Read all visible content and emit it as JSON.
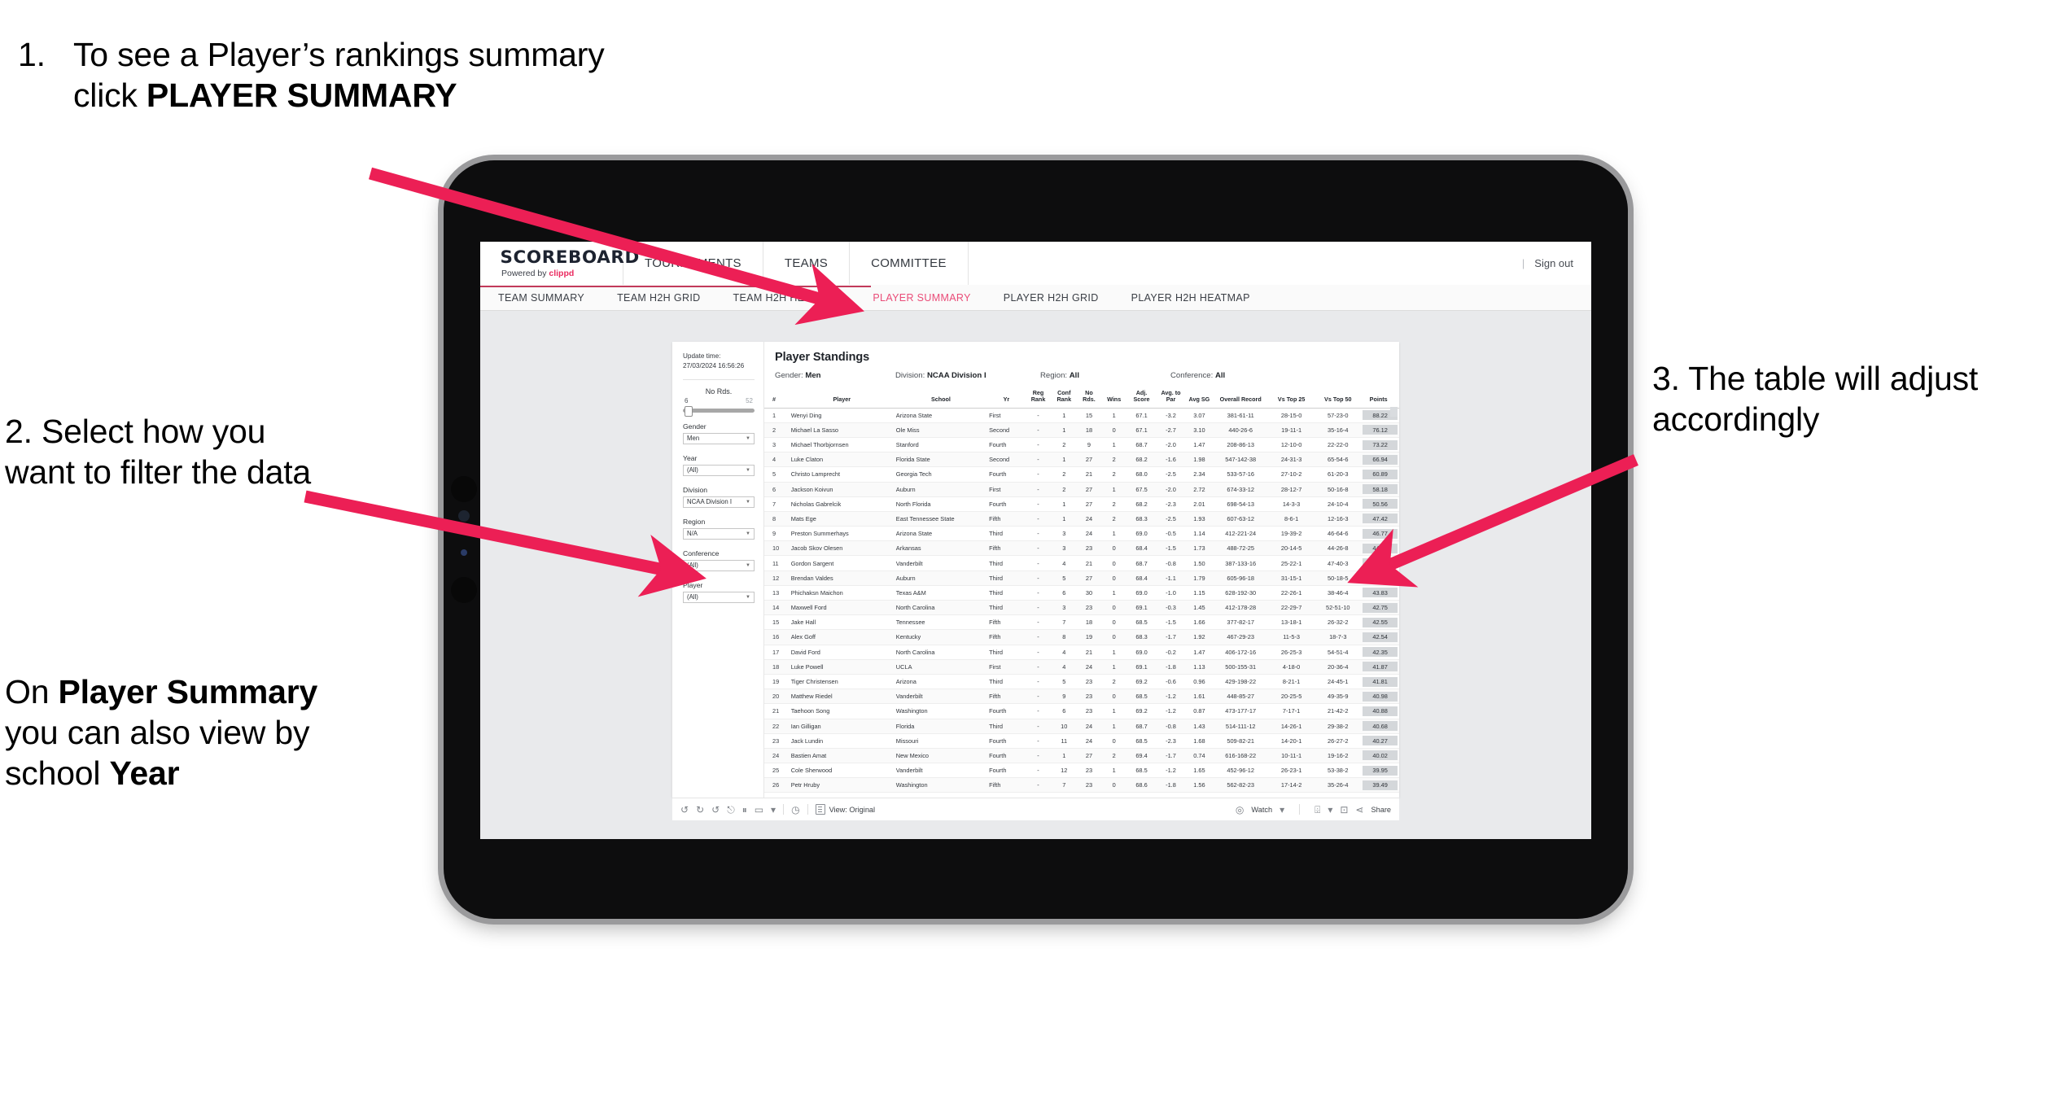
{
  "annotations": {
    "step1_num": "1.",
    "step1_pre": "To see a Player’s rankings summary click ",
    "step1_bold": "PLAYER SUMMARY",
    "step2": "2. Select how you want to filter the data",
    "step2b_pre": "On ",
    "step2b_bold1": "Player Summary",
    "step2b_mid": " you can also view by school ",
    "step2b_bold2": "Year",
    "step3": "3. The table will adjust accordingly",
    "arrow_color": "#ec1f55"
  },
  "app": {
    "brand_name": "SCOREBOARD",
    "brand_sub_pre": "Powered by ",
    "brand_sub_hl": "clippd",
    "top_nav": [
      "TOURNAMENTS",
      "TEAMS",
      "COMMITTEE"
    ],
    "top_right": {
      "divider": "|",
      "sign_out": "Sign out"
    },
    "sub_nav": [
      {
        "label": "TEAM SUMMARY",
        "active": false
      },
      {
        "label": "TEAM H2H GRID",
        "active": false
      },
      {
        "label": "TEAM H2H HEATMAP",
        "active": false
      },
      {
        "label": "PLAYER SUMMARY",
        "active": true
      },
      {
        "label": "PLAYER H2H GRID",
        "active": false
      },
      {
        "label": "PLAYER H2H HEATMAP",
        "active": false
      }
    ],
    "accent": "#ea4c78"
  },
  "filters": {
    "update_label": "Update time:",
    "update_value": "27/03/2024 16:56:26",
    "slider": {
      "title": "No Rds.",
      "min": "6",
      "max": "52"
    },
    "groups": [
      {
        "label": "Gender",
        "value": "Men"
      },
      {
        "label": "Year",
        "value": "(All)"
      },
      {
        "label": "Division",
        "value": "NCAA Division I"
      },
      {
        "label": "Region",
        "value": "N/A"
      },
      {
        "label": "Conference",
        "value": "(All)"
      },
      {
        "label": "Player",
        "value": "(All)"
      }
    ]
  },
  "standings": {
    "title": "Player Standings",
    "meta": [
      {
        "label": "Gender:",
        "value": "Men"
      },
      {
        "label": "Division:",
        "value": "NCAA Division I"
      },
      {
        "label": "Region:",
        "value": "All"
      },
      {
        "label": "Conference:",
        "value": "All"
      }
    ],
    "columns": [
      "#",
      "Player",
      "School",
      "Yr",
      "Reg Rank",
      "Conf Rank",
      "No Rds.",
      "Wins",
      "Adj. Score",
      "Avg. to Par",
      "Avg SG",
      "Overall Record",
      "Vs Top 25",
      "Vs Top 50",
      "Points"
    ],
    "rows": [
      [
        "1",
        "Wenyi Ding",
        "Arizona State",
        "First",
        "-",
        "1",
        "15",
        "1",
        "67.1",
        "-3.2",
        "3.07",
        "381-61-11",
        "28-15-0",
        "57-23-0",
        "88.22"
      ],
      [
        "2",
        "Michael La Sasso",
        "Ole Miss",
        "Second",
        "-",
        "1",
        "18",
        "0",
        "67.1",
        "-2.7",
        "3.10",
        "440-26-6",
        "19-11-1",
        "35-16-4",
        "76.12"
      ],
      [
        "3",
        "Michael Thorbjornsen",
        "Stanford",
        "Fourth",
        "-",
        "2",
        "9",
        "1",
        "68.7",
        "-2.0",
        "1.47",
        "208-86-13",
        "12-10-0",
        "22-22-0",
        "73.22"
      ],
      [
        "4",
        "Luke Claton",
        "Florida State",
        "Second",
        "-",
        "1",
        "27",
        "2",
        "68.2",
        "-1.6",
        "1.98",
        "547-142-38",
        "24-31-3",
        "65-54-6",
        "66.94"
      ],
      [
        "5",
        "Christo Lamprecht",
        "Georgia Tech",
        "Fourth",
        "-",
        "2",
        "21",
        "2",
        "68.0",
        "-2.5",
        "2.34",
        "533-57-16",
        "27-10-2",
        "61-20-3",
        "60.89"
      ],
      [
        "6",
        "Jackson Koivun",
        "Auburn",
        "First",
        "-",
        "2",
        "27",
        "1",
        "67.5",
        "-2.0",
        "2.72",
        "674-33-12",
        "28-12-7",
        "50-16-8",
        "58.18"
      ],
      [
        "7",
        "Nicholas Gabrelcik",
        "North Florida",
        "Fourth",
        "-",
        "1",
        "27",
        "2",
        "68.2",
        "-2.3",
        "2.01",
        "698-54-13",
        "14-3-3",
        "24-10-4",
        "50.56"
      ],
      [
        "8",
        "Mats Ege",
        "East Tennessee State",
        "Fifth",
        "-",
        "1",
        "24",
        "2",
        "68.3",
        "-2.5",
        "1.93",
        "607-63-12",
        "8-6-1",
        "12-16-3",
        "47.42"
      ],
      [
        "9",
        "Preston Summerhays",
        "Arizona State",
        "Third",
        "-",
        "3",
        "24",
        "1",
        "69.0",
        "-0.5",
        "1.14",
        "412-221-24",
        "19-39-2",
        "46-64-6",
        "46.77"
      ],
      [
        "10",
        "Jacob Skov Olesen",
        "Arkansas",
        "Fifth",
        "-",
        "3",
        "23",
        "0",
        "68.4",
        "-1.5",
        "1.73",
        "488-72-25",
        "20-14-5",
        "44-26-8",
        "44.82"
      ],
      [
        "11",
        "Gordon Sargent",
        "Vanderbilt",
        "Third",
        "-",
        "4",
        "21",
        "0",
        "68.7",
        "-0.8",
        "1.50",
        "387-133-16",
        "25-22-1",
        "47-40-3",
        "44.49"
      ],
      [
        "12",
        "Brendan Valdes",
        "Auburn",
        "Third",
        "-",
        "5",
        "27",
        "0",
        "68.4",
        "-1.1",
        "1.79",
        "605-96-18",
        "31-15-1",
        "50-18-5",
        "43.95"
      ],
      [
        "13",
        "Phichaksn Maichon",
        "Texas A&M",
        "Third",
        "-",
        "6",
        "30",
        "1",
        "69.0",
        "-1.0",
        "1.15",
        "628-192-30",
        "22-26-1",
        "38-46-4",
        "43.83"
      ],
      [
        "14",
        "Maxwell Ford",
        "North Carolina",
        "Third",
        "-",
        "3",
        "23",
        "0",
        "69.1",
        "-0.3",
        "1.45",
        "412-178-28",
        "22-29-7",
        "52-51-10",
        "42.75"
      ],
      [
        "15",
        "Jake Hall",
        "Tennessee",
        "Fifth",
        "-",
        "7",
        "18",
        "0",
        "68.5",
        "-1.5",
        "1.66",
        "377-82-17",
        "13-18-1",
        "26-32-2",
        "42.55"
      ],
      [
        "16",
        "Alex Goff",
        "Kentucky",
        "Fifth",
        "-",
        "8",
        "19",
        "0",
        "68.3",
        "-1.7",
        "1.92",
        "467-29-23",
        "11-5-3",
        "18-7-3",
        "42.54"
      ],
      [
        "17",
        "David Ford",
        "North Carolina",
        "Third",
        "-",
        "4",
        "21",
        "1",
        "69.0",
        "-0.2",
        "1.47",
        "406-172-16",
        "26-25-3",
        "54-51-4",
        "42.35"
      ],
      [
        "18",
        "Luke Powell",
        "UCLA",
        "First",
        "-",
        "4",
        "24",
        "1",
        "69.1",
        "-1.8",
        "1.13",
        "500-155-31",
        "4-18-0",
        "20-36-4",
        "41.87"
      ],
      [
        "19",
        "Tiger Christensen",
        "Arizona",
        "Third",
        "-",
        "5",
        "23",
        "2",
        "69.2",
        "-0.6",
        "0.96",
        "429-198-22",
        "8-21-1",
        "24-45-1",
        "41.81"
      ],
      [
        "20",
        "Matthew Riedel",
        "Vanderbilt",
        "Fifth",
        "-",
        "9",
        "23",
        "0",
        "68.5",
        "-1.2",
        "1.61",
        "448-85-27",
        "20-25-5",
        "49-35-9",
        "40.98"
      ],
      [
        "21",
        "Taehoon Song",
        "Washington",
        "Fourth",
        "-",
        "6",
        "23",
        "1",
        "69.2",
        "-1.2",
        "0.87",
        "473-177-17",
        "7-17-1",
        "21-42-2",
        "40.88"
      ],
      [
        "22",
        "Ian Gilligan",
        "Florida",
        "Third",
        "-",
        "10",
        "24",
        "1",
        "68.7",
        "-0.8",
        "1.43",
        "514-111-12",
        "14-26-1",
        "29-38-2",
        "40.68"
      ],
      [
        "23",
        "Jack Lundin",
        "Missouri",
        "Fourth",
        "-",
        "11",
        "24",
        "0",
        "68.5",
        "-2.3",
        "1.68",
        "509-82-21",
        "14-20-1",
        "26-27-2",
        "40.27"
      ],
      [
        "24",
        "Bastien Amat",
        "New Mexico",
        "Fourth",
        "-",
        "1",
        "27",
        "2",
        "69.4",
        "-1.7",
        "0.74",
        "616-168-22",
        "10-11-1",
        "19-16-2",
        "40.02"
      ],
      [
        "25",
        "Cole Sherwood",
        "Vanderbilt",
        "Fourth",
        "-",
        "12",
        "23",
        "1",
        "68.5",
        "-1.2",
        "1.65",
        "452-96-12",
        "26-23-1",
        "53-38-2",
        "39.95"
      ],
      [
        "26",
        "Petr Hruby",
        "Washington",
        "Fifth",
        "-",
        "7",
        "23",
        "0",
        "68.6",
        "-1.8",
        "1.56",
        "562-82-23",
        "17-14-2",
        "35-26-4",
        "39.49"
      ]
    ]
  },
  "toolbar": {
    "undo_icon": "undo-icon",
    "redo_icon": "redo-icon",
    "revert_icon": "revert-icon",
    "refresh_icon": "refresh-data-icon",
    "pause_icon": "pause-auto-updates-icon",
    "device_icon": "device-layout-icon",
    "dropdown_caret": "▾",
    "history_icon": "history-icon",
    "view_label": "View: Original",
    "watch_label": "Watch",
    "alert_icon": "alerts-icon",
    "subscribe_icon": "subscribe-icon",
    "share_label": "Share"
  }
}
